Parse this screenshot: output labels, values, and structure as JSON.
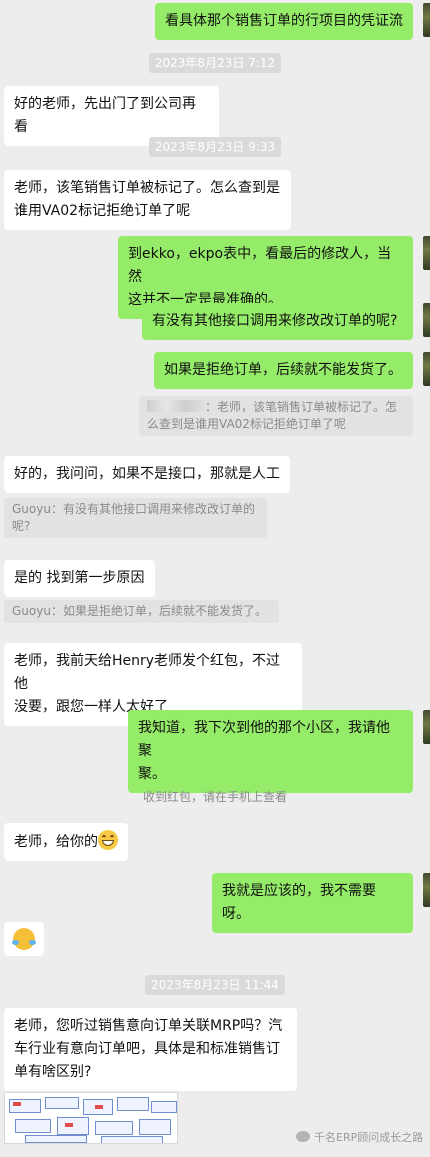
{
  "messages": {
    "m1": "看具体那个销售订单的行项目的凭证流",
    "t1": "2023年8月23日 7:12",
    "m2": "好的老师，先出门了到公司再看",
    "t2": "2023年8月23日 9:33",
    "m3a": "老师，该笔销售订单被标记了。怎么查到是",
    "m3b": "谁用VA02标记拒绝订单了呢",
    "m4a": "到ekko，ekpo表中，看最后的修改人，当然",
    "m4b": "这并不一定是最准确的。",
    "m5": "有没有其他接口调用来修改改订单的呢?",
    "m6": "如果是拒绝订单，后续就不能发货了。",
    "q1a": "：老师，该笔销售订单被标记了。怎",
    "q1b": "么查到是谁用VA02标记拒绝订单了呢",
    "m7": "好的，我问问，如果不是接口，那就是人工",
    "q2a": "Guoyu：有没有其他接口调用来修改改订单的",
    "q2b": "呢?",
    "m8": "是的  找到第一步原因",
    "q3": "Guoyu：如果是拒绝订单，后续就不能发货了。",
    "m9a": "老师，我前天给Henry老师发个红包，不过他",
    "m9b": "没要，跟您一样人太好了",
    "m10a": "我知道，我下次到他的那个小区，我请他聚",
    "m10b": "聚。",
    "sys1": "收到红包，请在手机上查看",
    "m11": "老师，给你的",
    "m12": "我就是应该的，我不需要呀。",
    "t3": "2023年8月23日 11:44",
    "m13a": "老师，您听过销售意向订单关联MRP吗？汽",
    "m13b": "车行业有意向订单吧，具体是和标准销售订",
    "m13c": "单有啥区别?",
    "watermark": "千名ERP顾问成长之路"
  },
  "icons": {
    "grin": "grinning-face-emoji",
    "laugh": "tears-of-joy-emoji",
    "wechat": "wechat-logo-icon"
  },
  "colors": {
    "self_bubble": "#95ec69",
    "other_bubble": "#ffffff",
    "background": "#ededed"
  }
}
